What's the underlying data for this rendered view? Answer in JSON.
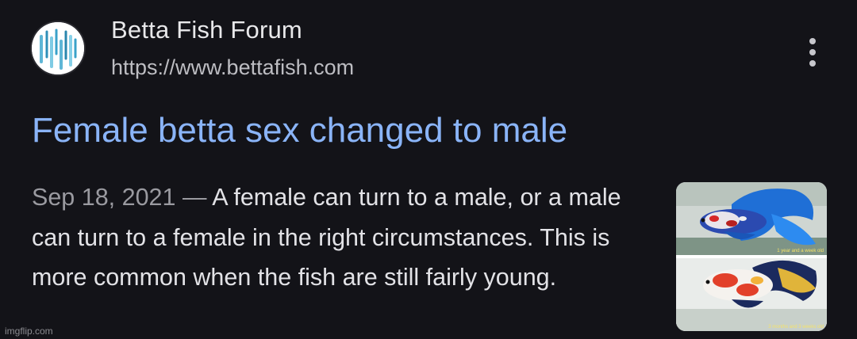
{
  "result": {
    "site_name": "Betta Fish Forum",
    "site_url": "https://www.bettafish.com",
    "title": "Female betta sex changed to male",
    "date": "Sep 18, 2021",
    "separator": " — ",
    "snippet": "A female can turn to a male, or a male can turn to a female in the right circumstances. This is more common when the fish are still fairly young.",
    "thumbnail": {
      "top_caption": "1 year and a week old",
      "bottom_caption": "3 months and 3 weeks old"
    }
  },
  "icons": {
    "favicon": "site-favicon-icon",
    "more": "more-vert-icon"
  },
  "colors": {
    "background": "#131318",
    "title_link": "#8ab4f8",
    "date": "#9a9aa0"
  },
  "watermark": "imgflip.com"
}
